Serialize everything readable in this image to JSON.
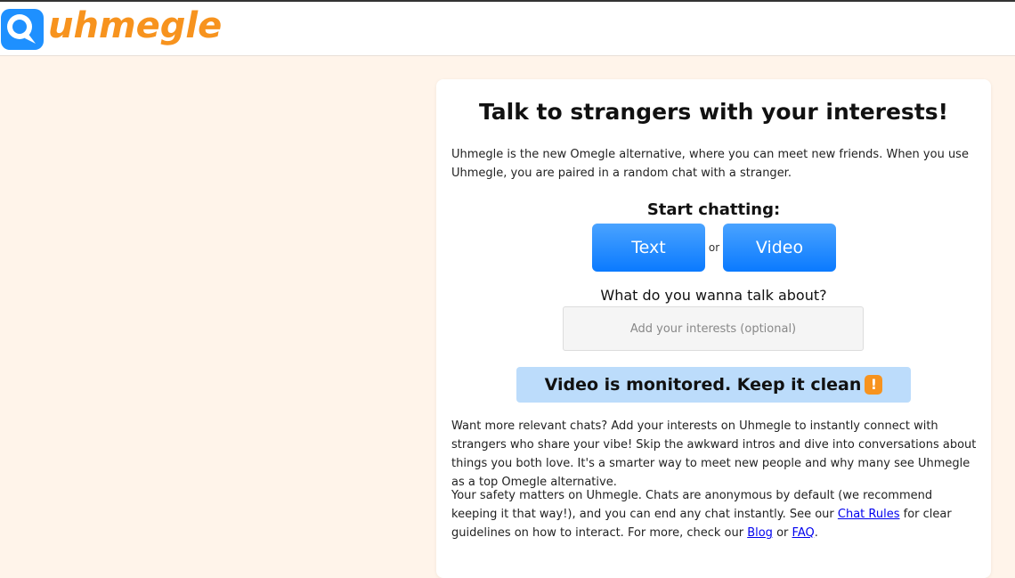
{
  "brand": {
    "name": "uhmegle",
    "logo_color": "#f7931e",
    "icon_color": "#1e90ff"
  },
  "hero": {
    "title": "Talk to strangers with your interests!",
    "intro": "Uhmegle is the new Omegle alternative, where you can meet new friends. When you use Uhmegle, you are paired in a random chat with a stranger."
  },
  "chat": {
    "start_label": "Start chatting:",
    "text_button": "Text",
    "or_label": "or",
    "video_button": "Video"
  },
  "interests": {
    "label": "What do you wanna talk about?",
    "placeholder": "Add your interests (optional)",
    "value": ""
  },
  "banner": {
    "text": "Video is monitored. Keep it clean",
    "icon": "exclamation-icon",
    "icon_glyph": "!"
  },
  "content": {
    "interests_paragraph": "Want more relevant chats? Add your interests on Uhmegle to instantly connect with strangers who share your vibe! Skip the awkward intros and dive into conversations about things you both love. It's a smarter way to meet new people and why many see Uhmegle as a top Omegle alternative.",
    "safety_part1": "Your safety matters on Uhmegle. Chats are anonymous by default (we recommend keeping it that way!), and you can end any chat instantly. See our ",
    "chat_rules_link": "Chat Rules",
    "safety_part2": " for clear guidelines on how to interact. For more, check our ",
    "blog_link": "Blog",
    "safety_or": " or ",
    "faq_link": "FAQ",
    "safety_end": "."
  },
  "colors": {
    "page_background": "#fff4ea",
    "button_blue": "#0a7aff",
    "banner_blue": "#bcdcfb",
    "link": "#0000ee"
  }
}
